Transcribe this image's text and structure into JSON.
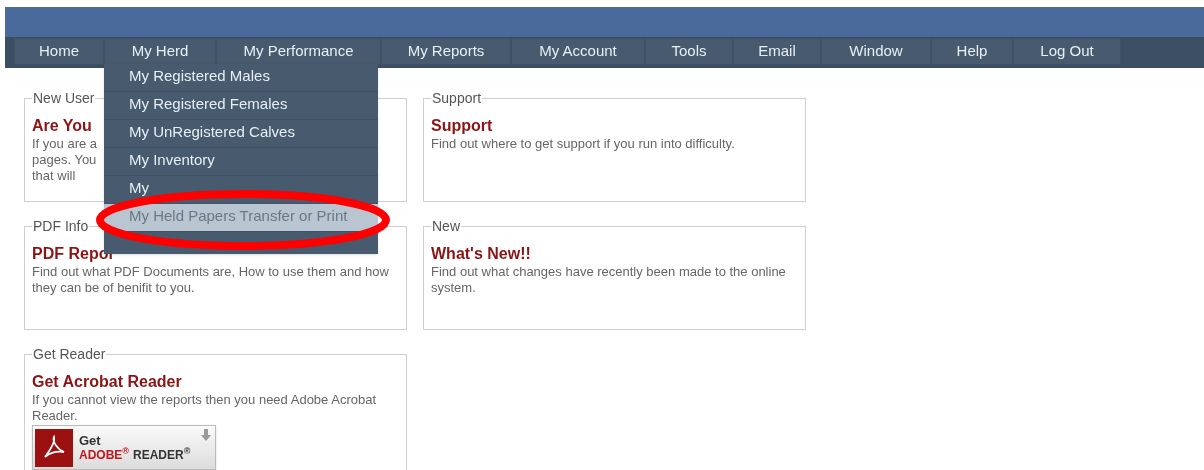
{
  "nav": [
    {
      "label": "Home"
    },
    {
      "label": "My Herd"
    },
    {
      "label": "My Performance"
    },
    {
      "label": "My Reports"
    },
    {
      "label": "My Account"
    },
    {
      "label": "Tools"
    },
    {
      "label": "Email"
    },
    {
      "label": "Window"
    },
    {
      "label": "Help"
    },
    {
      "label": "Log Out"
    }
  ],
  "dropdown": [
    {
      "label": "My Registered Males",
      "selected": false
    },
    {
      "label": "My Registered Females",
      "selected": false
    },
    {
      "label": "My UnRegistered Calves",
      "selected": false
    },
    {
      "label": "My Inventory",
      "selected": false
    },
    {
      "label": "My",
      "selected": false
    },
    {
      "label": "My Held Papers Transfer or Print",
      "selected": true
    }
  ],
  "panels": [
    {
      "legend": "New User",
      "title": "Are You",
      "lines": [
        "If you are a",
        "pages. You",
        "that will"
      ]
    },
    {
      "legend": "Support",
      "title": "Support",
      "lines": [
        "Find out where to get support if you run into difficulty."
      ]
    },
    {
      "legend": "PDF Info",
      "title": "PDF Repor",
      "lines": [
        "Find out what PDF Documents are, How to use them and how",
        "they can be of benifit to you."
      ]
    },
    {
      "legend": "New",
      "title": "What's New!!",
      "lines": [
        "Find out what changes have recently been made to the online",
        "system."
      ]
    },
    {
      "legend": "Get Reader",
      "title": "Get Acrobat Reader",
      "lines": [
        "If you cannot view the reports then you need Adobe Acrobat",
        "Reader."
      ],
      "badge": {
        "top": "Get",
        "brand": "ADOBE$^{®}$",
        "product": "READER$^{®}$"
      }
    }
  ]
}
